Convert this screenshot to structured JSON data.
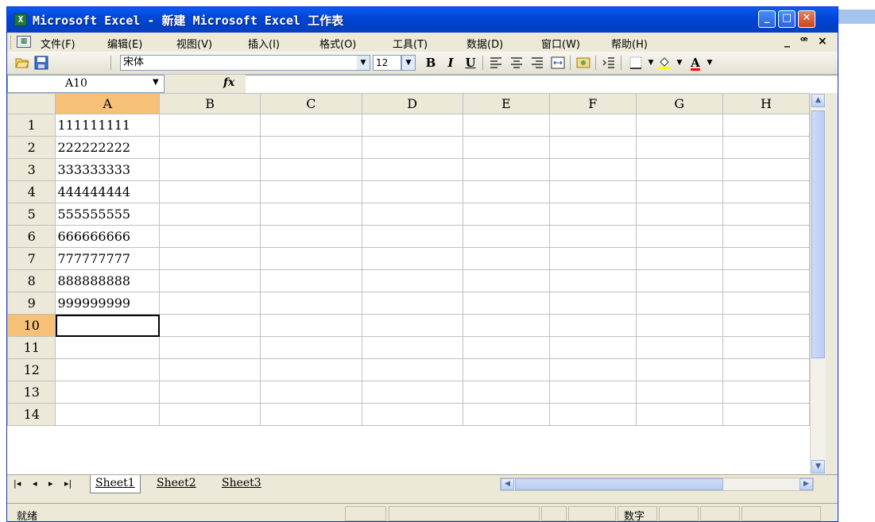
{
  "window": {
    "title": "Microsoft Excel - 新建 Microsoft Excel 工作表",
    "controls": {
      "minimize": "_",
      "restore": "□",
      "close": "✕"
    }
  },
  "menu": {
    "items": [
      "文件(F)",
      "编辑(E)",
      "视图(V)",
      "插入(I)",
      "格式(O)",
      "工具(T)",
      "数据(D)",
      "窗口(W)",
      "帮助(H)"
    ],
    "mdi_min": "_",
    "mdi_restore": "ꟹ",
    "mdi_close": "×"
  },
  "toolbar": {
    "font_name": "宋体",
    "font_size": "12",
    "bold": "B",
    "italic": "I",
    "underline": "U",
    "font_color_glyph": "A"
  },
  "formula": {
    "name_box": "A10",
    "fx": "fx",
    "content": ""
  },
  "sheet": {
    "columns": [
      "A",
      "B",
      "C",
      "D",
      "E",
      "F",
      "G",
      "H"
    ],
    "rows": [
      "1",
      "2",
      "3",
      "4",
      "5",
      "6",
      "7",
      "8",
      "9",
      "10",
      "11",
      "12",
      "13",
      "14"
    ],
    "col_a_values": [
      "111111111",
      "222222222",
      "333333333",
      "444444444",
      "555555555",
      "666666666",
      "777777777",
      "888888888",
      "999999999",
      "",
      "",
      "",
      "",
      ""
    ],
    "active_cell": "A10",
    "header_highlight": "#f6c177",
    "grid_color": "#c0c0c0"
  },
  "tabs": {
    "nav": [
      "|◂",
      "◂",
      "▸",
      "▸|"
    ],
    "names": [
      "Sheet1",
      "Sheet2",
      "Sheet3"
    ],
    "active": "Sheet1"
  },
  "status": {
    "ready": "就绪",
    "num": "数字"
  }
}
